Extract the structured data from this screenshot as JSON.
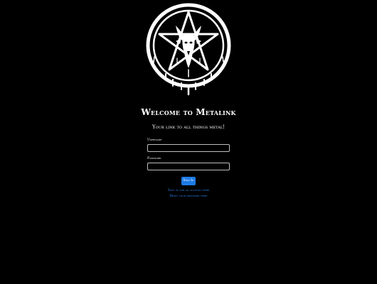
{
  "header": {
    "logo_icon": "pentagram-goat-icon",
    "title": "Welcome to Metalink",
    "tagline": "Your link to all things metal!"
  },
  "login_form": {
    "username_label": "Username",
    "username_value": "",
    "password_label": "Password",
    "password_value": "",
    "submit_label": "Sign In"
  },
  "links": {
    "signup": "Sign up for an account here",
    "reset": "Reset your password here"
  },
  "colors": {
    "background": "#000000",
    "text": "#ffffff",
    "button": "#1e7be6",
    "link": "#2f86f0"
  }
}
